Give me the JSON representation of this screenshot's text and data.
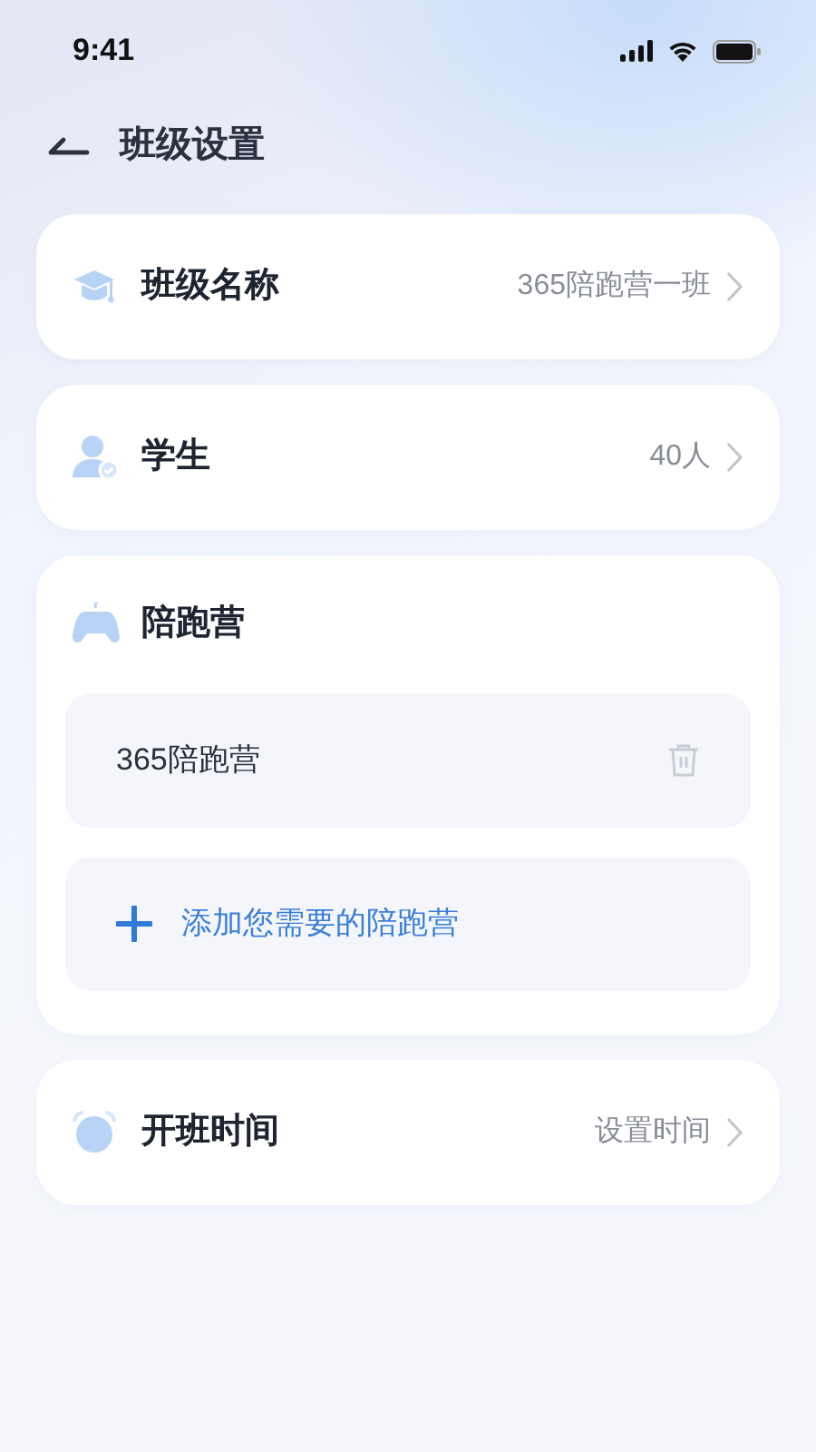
{
  "status_bar": {
    "time": "9:41"
  },
  "header": {
    "title": "班级设置"
  },
  "sections": [
    {
      "kind": "row",
      "label": "班级名称",
      "value": "365陪跑营一班"
    },
    {
      "kind": "row",
      "label": "学生",
      "value": "40人"
    },
    {
      "kind": "group",
      "label": "陪跑营",
      "items": [
        {
          "name": "365陪跑营"
        }
      ],
      "add_label": "添加您需要的陪跑营"
    },
    {
      "kind": "row",
      "label": "开班时间",
      "value": "设置时间"
    }
  ]
}
